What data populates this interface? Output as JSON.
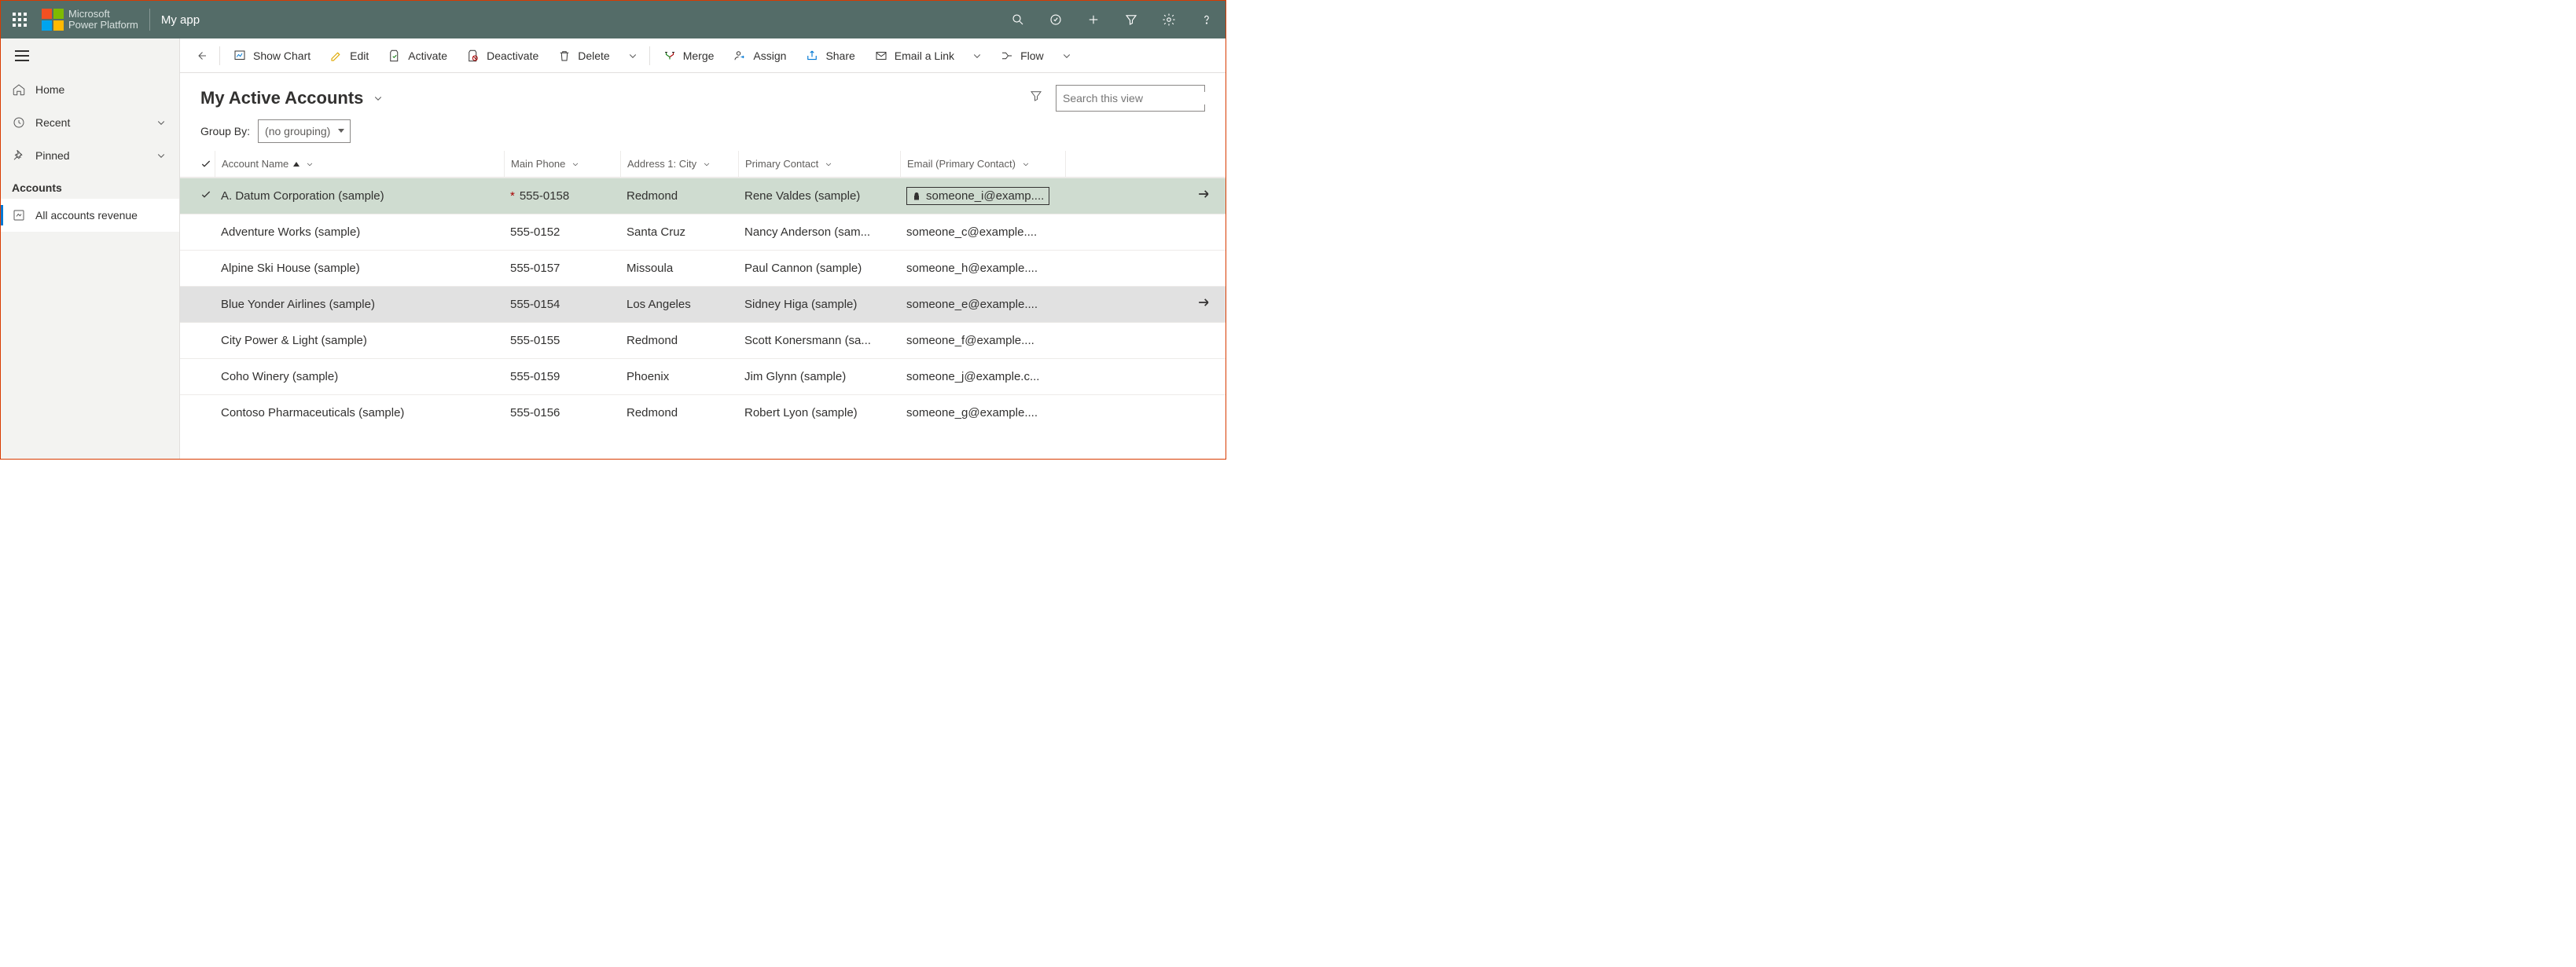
{
  "topbar": {
    "brand1": "Microsoft",
    "brand2": "Power Platform",
    "app_name": "My app"
  },
  "sidebar": {
    "home": "Home",
    "recent": "Recent",
    "pinned": "Pinned",
    "group_header": "Accounts",
    "subitem": "All accounts revenue"
  },
  "cmdbar": {
    "show_chart": "Show Chart",
    "edit": "Edit",
    "activate": "Activate",
    "deactivate": "Deactivate",
    "delete": "Delete",
    "merge": "Merge",
    "assign": "Assign",
    "share": "Share",
    "email_link": "Email a Link",
    "flow": "Flow"
  },
  "view": {
    "title": "My Active Accounts",
    "search_placeholder": "Search this view"
  },
  "groupby": {
    "label": "Group By:",
    "value": "(no grouping)"
  },
  "columns": {
    "name": "Account Name",
    "phone": "Main Phone",
    "city": "Address 1: City",
    "contact": "Primary Contact",
    "email": "Email (Primary Contact)"
  },
  "rows": [
    {
      "name": "A. Datum Corporation (sample)",
      "phone": "555-0158",
      "city": "Redmond",
      "contact": "Rene Valdes (sample)",
      "email": "someone_i@examp....",
      "selected": true,
      "locked": true,
      "required": true,
      "arrow": true
    },
    {
      "name": "Adventure Works (sample)",
      "phone": "555-0152",
      "city": "Santa Cruz",
      "contact": "Nancy Anderson (sam...",
      "email": "someone_c@example...."
    },
    {
      "name": "Alpine Ski House (sample)",
      "phone": "555-0157",
      "city": "Missoula",
      "contact": "Paul Cannon (sample)",
      "email": "someone_h@example...."
    },
    {
      "name": "Blue Yonder Airlines (sample)",
      "phone": "555-0154",
      "city": "Los Angeles",
      "contact": "Sidney Higa (sample)",
      "email": "someone_e@example....",
      "hover": true,
      "arrow": true
    },
    {
      "name": "City Power & Light (sample)",
      "phone": "555-0155",
      "city": "Redmond",
      "contact": "Scott Konersmann (sa...",
      "email": "someone_f@example...."
    },
    {
      "name": "Coho Winery (sample)",
      "phone": "555-0159",
      "city": "Phoenix",
      "contact": "Jim Glynn (sample)",
      "email": "someone_j@example.c..."
    },
    {
      "name": "Contoso Pharmaceuticals (sample)",
      "phone": "555-0156",
      "city": "Redmond",
      "contact": "Robert Lyon (sample)",
      "email": "someone_g@example...."
    }
  ]
}
